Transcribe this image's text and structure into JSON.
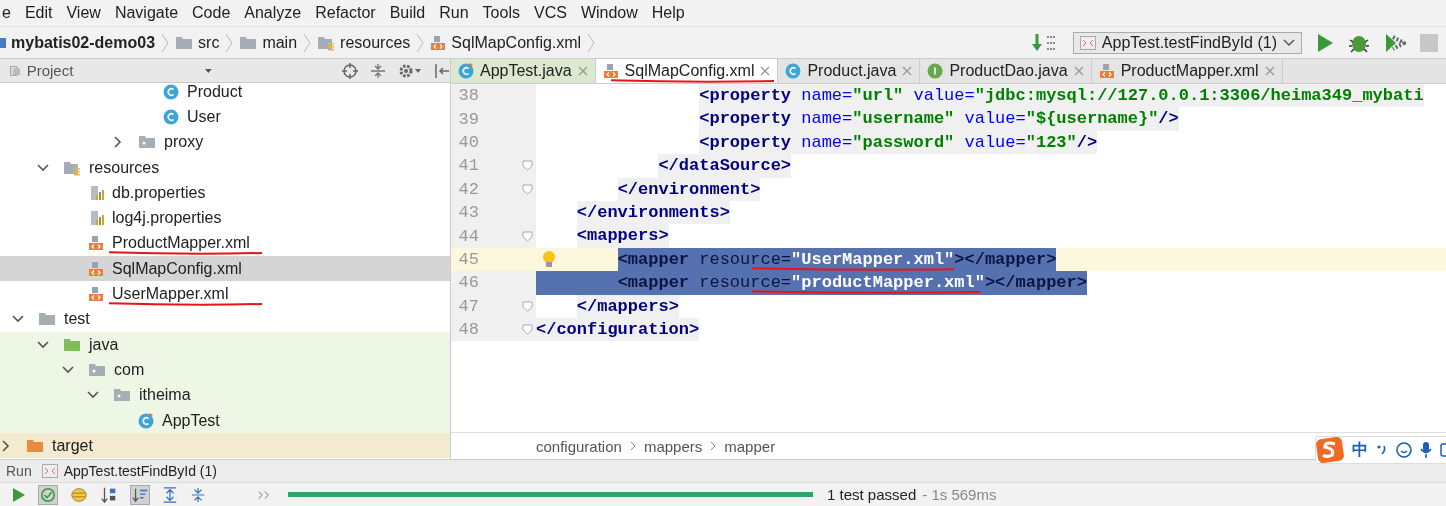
{
  "menu": [
    "e",
    "Edit",
    "View",
    "Navigate",
    "Code",
    "Analyze",
    "Refactor",
    "Build",
    "Run",
    "Tools",
    "VCS",
    "Window",
    "Help"
  ],
  "breadcrumb": [
    {
      "label": "mybatis02-demo03",
      "kind": "module"
    },
    {
      "label": "src",
      "kind": "folder"
    },
    {
      "label": "main",
      "kind": "folder"
    },
    {
      "label": "resources",
      "kind": "resources"
    },
    {
      "label": "SqlMapConfig.xml",
      "kind": "xml"
    }
  ],
  "run_config": {
    "label": "AppTest.testFindById (1)"
  },
  "project_panel": {
    "title": "Project"
  },
  "tabs": [
    {
      "label": "AppTest.java",
      "kind": "test-class",
      "selected": false,
      "underlined": false
    },
    {
      "label": "SqlMapConfig.xml",
      "kind": "xml",
      "selected": true,
      "underlined": true
    },
    {
      "label": "Product.java",
      "kind": "class",
      "selected": false,
      "underlined": false
    },
    {
      "label": "ProductDao.java",
      "kind": "interface",
      "selected": false,
      "underlined": false
    },
    {
      "label": "ProductMapper.xml",
      "kind": "xml",
      "selected": false,
      "underlined": false
    }
  ],
  "tree": [
    {
      "children": [
        {
          "children": [
            {
              "children": [
                {
                  "children": [
                    {
                      "children": [
                        {
                          "children": [
                            {
                              "label": "Product",
                              "kind": "class",
                              "selected": false
                            },
                            {
                              "label": "User",
                              "kind": "class",
                              "selected": false
                            }
                          ]
                        },
                        {
                          "label": "proxy",
                          "kind": "package",
                          "expanded": false,
                          "selected": false
                        }
                      ]
                    }
                  ]
                }
              ]
            },
            {
              "label": "resources",
              "kind": "resources",
              "expanded": true,
              "selected": false,
              "children": [
                {
                  "label": "db.properties",
                  "kind": "properties",
                  "selected": false
                },
                {
                  "label": "log4j.properties",
                  "kind": "properties",
                  "selected": false
                },
                {
                  "label": "ProductMapper.xml",
                  "kind": "xml",
                  "selected": false,
                  "underlined": true
                },
                {
                  "label": "SqlMapConfig.xml",
                  "kind": "xml",
                  "selected": true,
                  "underlined": false
                },
                {
                  "label": "UserMapper.xml",
                  "kind": "xml",
                  "selected": false,
                  "underlined": true
                }
              ]
            }
          ]
        },
        {
          "label": "test",
          "kind": "folder",
          "expanded": true,
          "selected": false,
          "children": [
            {
              "label": "java",
              "kind": "test-root",
              "expanded": true,
              "selected": false,
              "children": [
                {
                  "label": "com",
                  "kind": "test-package",
                  "expanded": true,
                  "selected": false,
                  "children": [
                    {
                      "label": "itheima",
                      "kind": "test-package",
                      "expanded": true,
                      "selected": false,
                      "children": [
                        {
                          "label": "AppTest",
                          "kind": "test-class",
                          "selected": false
                        }
                      ]
                    }
                  ]
                }
              ]
            }
          ]
        }
      ]
    },
    {
      "label": "target",
      "kind": "excluded",
      "expanded": false,
      "selected": false
    }
  ],
  "editor": {
    "lines": [
      {
        "number": "38",
        "current": false,
        "fold": false,
        "hint": false,
        "selected": false,
        "tokens": [
          {
            "kind": "tag",
            "text": "                <property"
          },
          {
            "kind": "attr",
            "text": " name="
          },
          {
            "kind": "value",
            "text": "\"url\""
          },
          {
            "kind": "attr",
            "text": " value="
          },
          {
            "kind": "value",
            "text": "\"jdbc:mysql://127.0.0.1:3306/heima349_mybati"
          }
        ]
      },
      {
        "number": "39",
        "current": false,
        "fold": false,
        "hint": false,
        "selected": false,
        "tokens": [
          {
            "kind": "tag",
            "text": "                <property"
          },
          {
            "kind": "attr",
            "text": " name="
          },
          {
            "kind": "value",
            "text": "\"username\""
          },
          {
            "kind": "attr",
            "text": " value="
          },
          {
            "kind": "value",
            "text": "\"${username}\""
          },
          {
            "kind": "tag",
            "text": "/>"
          }
        ]
      },
      {
        "number": "40",
        "current": false,
        "fold": false,
        "hint": false,
        "selected": false,
        "tokens": [
          {
            "kind": "tag",
            "text": "                <property"
          },
          {
            "kind": "attr",
            "text": " name="
          },
          {
            "kind": "value",
            "text": "\"password\""
          },
          {
            "kind": "attr",
            "text": " value="
          },
          {
            "kind": "value",
            "text": "\"123\""
          },
          {
            "kind": "tag",
            "text": "/>"
          }
        ]
      },
      {
        "number": "41",
        "current": false,
        "fold": true,
        "hint": false,
        "selected": false,
        "tokens": [
          {
            "kind": "tag",
            "text": "            </dataSource>"
          }
        ]
      },
      {
        "number": "42",
        "current": false,
        "fold": true,
        "hint": false,
        "selected": false,
        "tokens": [
          {
            "kind": "tag",
            "text": "        </environment>"
          }
        ]
      },
      {
        "number": "43",
        "current": false,
        "fold": false,
        "hint": false,
        "selected": false,
        "tokens": [
          {
            "kind": "tag",
            "text": "    </environments>"
          }
        ]
      },
      {
        "number": "44",
        "current": false,
        "fold": true,
        "hint": false,
        "selected": false,
        "tokens": [
          {
            "kind": "tag",
            "text": "    <mappers>"
          }
        ]
      },
      {
        "number": "45",
        "current": true,
        "fold": false,
        "hint": true,
        "selected": true,
        "indent_selected": false,
        "tokens": [
          {
            "kind": "tag",
            "text": "        <mapper"
          },
          {
            "kind": "attr",
            "text": " resource="
          },
          {
            "kind": "value",
            "text": "\"UserMapper.xml\"",
            "underlined": true
          },
          {
            "kind": "tag",
            "text": "></mapper>"
          }
        ]
      },
      {
        "number": "46",
        "current": false,
        "fold": false,
        "hint": false,
        "selected": true,
        "indent_selected": true,
        "tokens": [
          {
            "kind": "tag",
            "text": "        <mapper"
          },
          {
            "kind": "attr",
            "text": " resource="
          },
          {
            "kind": "value",
            "text": "\"productMapper.xml\"",
            "underlined": true
          },
          {
            "kind": "tag",
            "text": "></mapper>"
          }
        ]
      },
      {
        "number": "47",
        "current": false,
        "fold": true,
        "hint": false,
        "selected": false,
        "tokens": [
          {
            "kind": "tag",
            "text": "    </mappers>"
          }
        ]
      },
      {
        "number": "48",
        "current": false,
        "fold": true,
        "hint": false,
        "selected": false,
        "tokens": [
          {
            "kind": "tag",
            "text": "</configuration>"
          }
        ]
      }
    ],
    "breadcrumb": [
      "configuration",
      "mappers",
      "mapper"
    ]
  },
  "ime_bar": {
    "label": "中"
  },
  "run_panel": {
    "title": "Run",
    "config": "AppTest.testFindById (1)",
    "progress": {
      "level": 1
    },
    "result": "1 test passed",
    "duration": "- 1s 569ms"
  }
}
